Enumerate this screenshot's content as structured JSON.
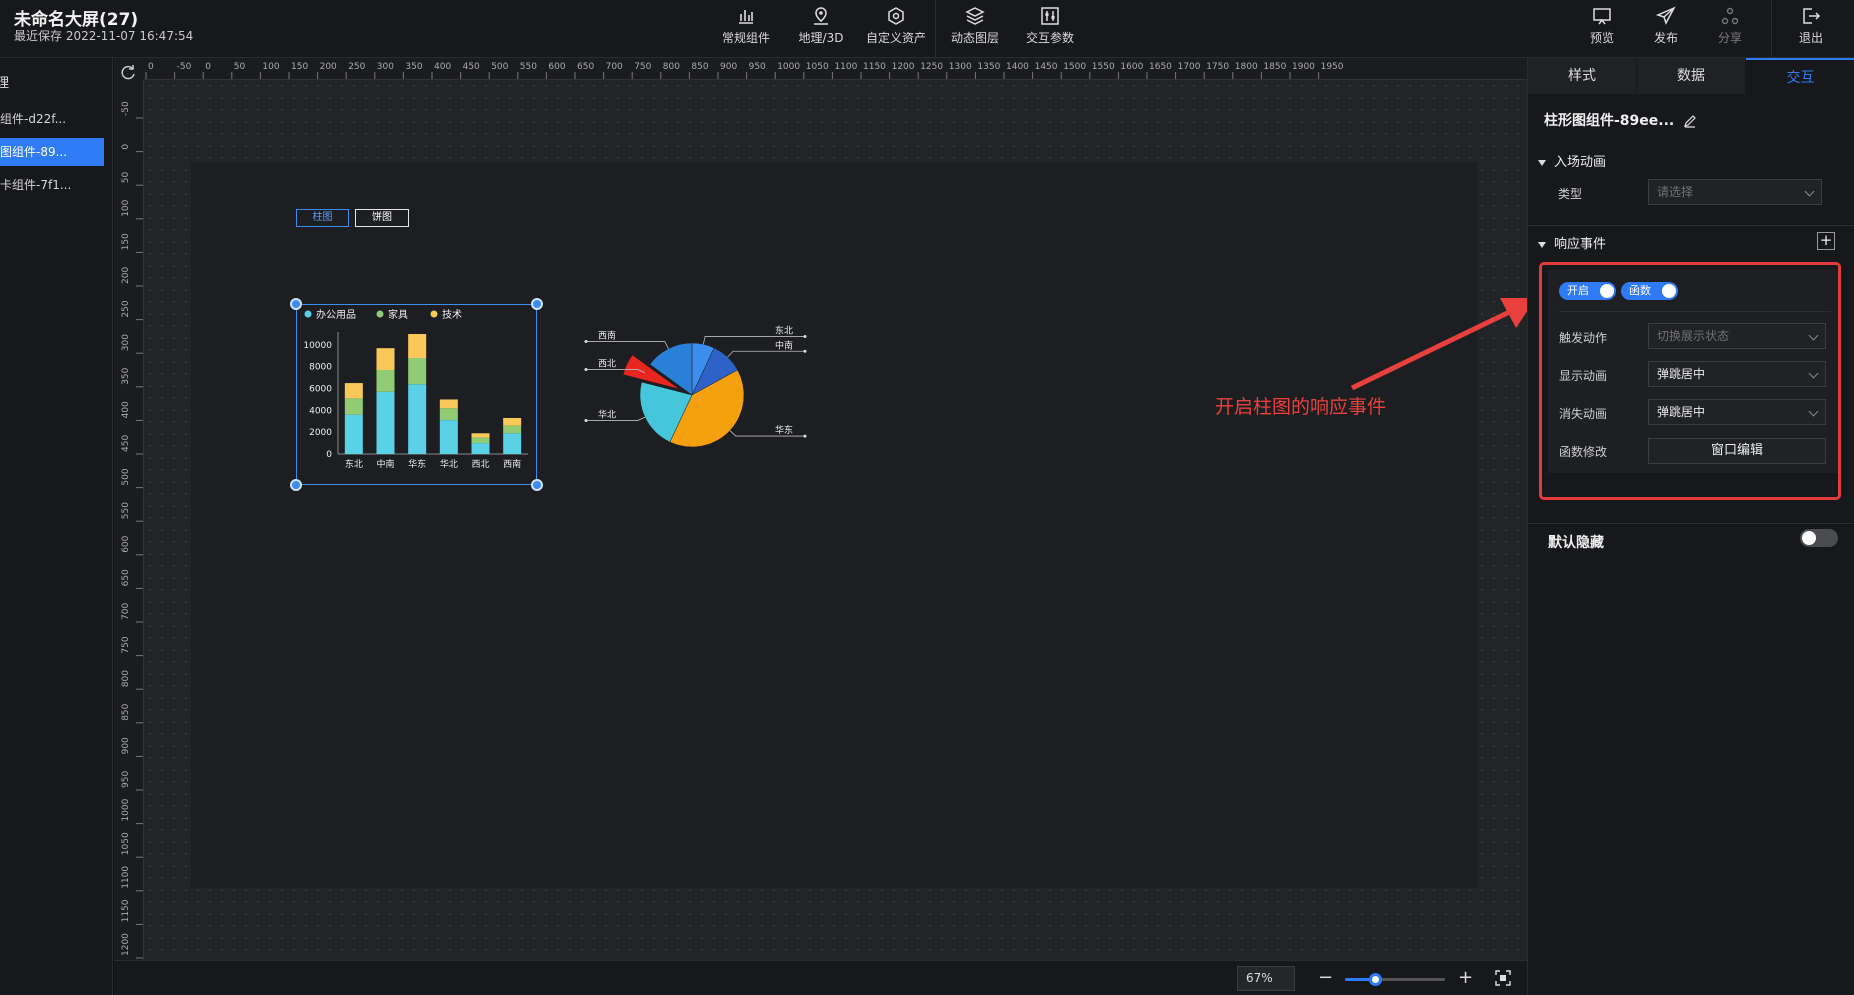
{
  "header": {
    "title": "未命名大屏(27)",
    "save_time": "最近保存 2022-11-07 16:47:54",
    "tools": [
      "常规组件",
      "地理/3D",
      "自定义资产",
      "动态图层",
      "交互参数"
    ],
    "actions": [
      "预览",
      "发布",
      "分享",
      "退出"
    ]
  },
  "layers": {
    "title": "理",
    "items": [
      "组件-d22f...",
      "图组件-89...",
      "卡组件-7f1..."
    ],
    "active_index": 1
  },
  "ruler": {
    "h_ticks": [
      "0",
      "-50",
      "0",
      "50",
      "100",
      "150",
      "200",
      "250",
      "300",
      "350",
      "400",
      "450",
      "500",
      "550",
      "600",
      "650",
      "700",
      "750",
      "800",
      "850",
      "900",
      "950",
      "1000",
      "1050",
      "1100",
      "1150",
      "1200",
      "1250",
      "1300",
      "1350",
      "1400",
      "1450",
      "1500",
      "1550",
      "1600",
      "1650",
      "1700",
      "1750",
      "1800",
      "1850",
      "1900",
      "1950"
    ],
    "v_ticks": [
      "-50",
      "0",
      "50",
      "100",
      "150",
      "200",
      "250",
      "300",
      "350",
      "400",
      "450",
      "500",
      "550",
      "600",
      "650",
      "700",
      "750",
      "800",
      "850",
      "900",
      "950",
      "1000",
      "1050",
      "1100",
      "1150",
      "1200"
    ]
  },
  "canvas_buttons": {
    "bar": "柱图",
    "pie": "饼图"
  },
  "chart_data": [
    {
      "type": "bar",
      "stacked": true,
      "categories": [
        "东北",
        "中南",
        "华东",
        "华北",
        "西北",
        "西南"
      ],
      "series": [
        {
          "name": "办公用品",
          "values": [
            3600,
            5700,
            6400,
            3100,
            1000,
            1900
          ],
          "color": "#5ad1e6"
        },
        {
          "name": "家具",
          "values": [
            1500,
            2000,
            2400,
            1100,
            500,
            700
          ],
          "color": "#91cc75"
        },
        {
          "name": "技术",
          "values": [
            1400,
            2000,
            2200,
            800,
            400,
            700
          ],
          "color": "#fac858"
        }
      ],
      "yticks": [
        "10000",
        "8000",
        "6000",
        "4000",
        "2000",
        "0"
      ],
      "ylim": [
        0,
        11000
      ]
    },
    {
      "type": "pie",
      "slices": [
        {
          "name": "东北",
          "value": 7,
          "color": "#3b8df0"
        },
        {
          "name": "中南",
          "value": 10,
          "color": "#2d63c8"
        },
        {
          "name": "华东",
          "value": 40,
          "color": "#f5a10f"
        },
        {
          "name": "华北",
          "value": 22,
          "color": "#45c6db"
        },
        {
          "name": "西北",
          "value": 6,
          "color": "#e8251f"
        },
        {
          "name": "西南",
          "value": 15,
          "color": "#2a7fd6"
        }
      ]
    }
  ],
  "bottom": {
    "zoom": "67%",
    "zoom_fraction": 0.3
  },
  "panel": {
    "tabs": [
      "样式",
      "数据",
      "交互"
    ],
    "active_tab": 2,
    "component_title": "柱形图组件-89ee...",
    "entry_anim": {
      "heading": "入场动画",
      "type_label": "类型",
      "type_placeholder": "请选择"
    },
    "events": {
      "heading": "响应事件",
      "toggle_on": "开启",
      "toggle_func": "函数",
      "trigger_label": "触发动作",
      "trigger_value": "切换展示状态",
      "show_label": "显示动画",
      "show_value": "弹跳居中",
      "hide_label": "消失动画",
      "hide_value": "弹跳居中",
      "func_label": "函数修改",
      "func_button": "窗口编辑"
    },
    "default_hidden": "默认隐藏"
  },
  "annotation": "开启柱图的响应事件",
  "colors": {
    "accent": "#2f7bf6",
    "annotation": "#e8403c"
  }
}
